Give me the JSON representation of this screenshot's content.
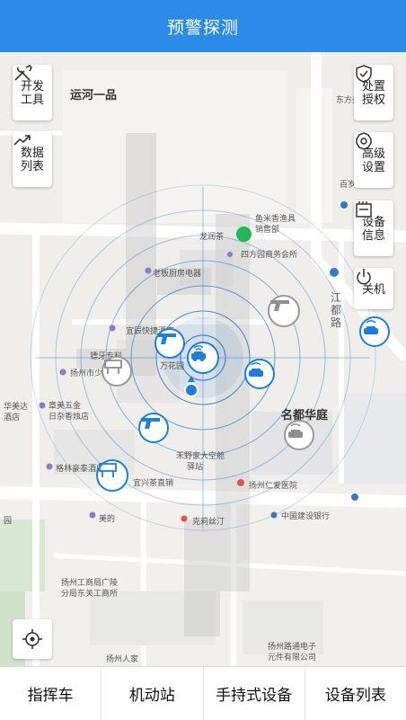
{
  "header": {
    "title": "预警探测"
  },
  "controls_left": [
    {
      "name": "dev-tools-button",
      "icon": "wrench-screwdriver-icon",
      "label": "开发\n工具"
    },
    {
      "name": "data-list-button",
      "icon": "trend-chart-icon",
      "label": "数据\n列表"
    }
  ],
  "controls_right": [
    {
      "name": "disposal-auth-button",
      "icon": "shield-check-icon",
      "label": "处置\n授权"
    },
    {
      "name": "advanced-settings-button",
      "icon": "gear-icon",
      "label": "高级\n设置"
    },
    {
      "name": "device-info-button",
      "icon": "device-icon",
      "label": "设备\n信息"
    },
    {
      "name": "power-off-button",
      "icon": "power-icon",
      "label": "关机"
    }
  ],
  "map": {
    "labels": {
      "yunhe": "运河一品",
      "yuzhou": "鱼米香渔具",
      "yuzhou2": "销售部",
      "longrun": "龙润茶",
      "sifang": "四方园商务会所",
      "laoban": "老板厨房电器",
      "yicheng": "宜辰快捷酒店",
      "wanhua": "万花园",
      "diaoya": "镖牙专科",
      "yangzhou_shao": "扬州市少年",
      "huamei": "华美达",
      "huamei2": "酒店",
      "zhangmei": "章美五金",
      "zhangmei2": "日杂香烛店",
      "gelin": "格林豪泰酒店",
      "heye": "禾野家大空舱",
      "heye2": "驿站",
      "yixing": "宜兴茶直销",
      "mingdu": "名都华庭",
      "renai": "扬州仁爱医院",
      "jianshe": "中国建设银行",
      "meide": "美的",
      "kelisi": "克莉丝汀",
      "gongshang": "扬州工商局广陵",
      "gongshang2": "分局东关工商所",
      "renjia": "扬州人家",
      "lutong": "扬州路通电子",
      "lutong2": "元件有限公司",
      "baifang": "百岁",
      "dongfang": "东方美",
      "jiangdu": "江都路",
      "yuan": "园"
    }
  },
  "tabs": [
    {
      "label": "指挥车"
    },
    {
      "label": "机动站"
    },
    {
      "label": "手持式设备"
    },
    {
      "label": "设备列表"
    }
  ],
  "colors": {
    "header": "#2a8be8",
    "accent": "#1e7fd8",
    "marker_gray": "#9a9a9a",
    "green_dot": "#22b85a"
  }
}
